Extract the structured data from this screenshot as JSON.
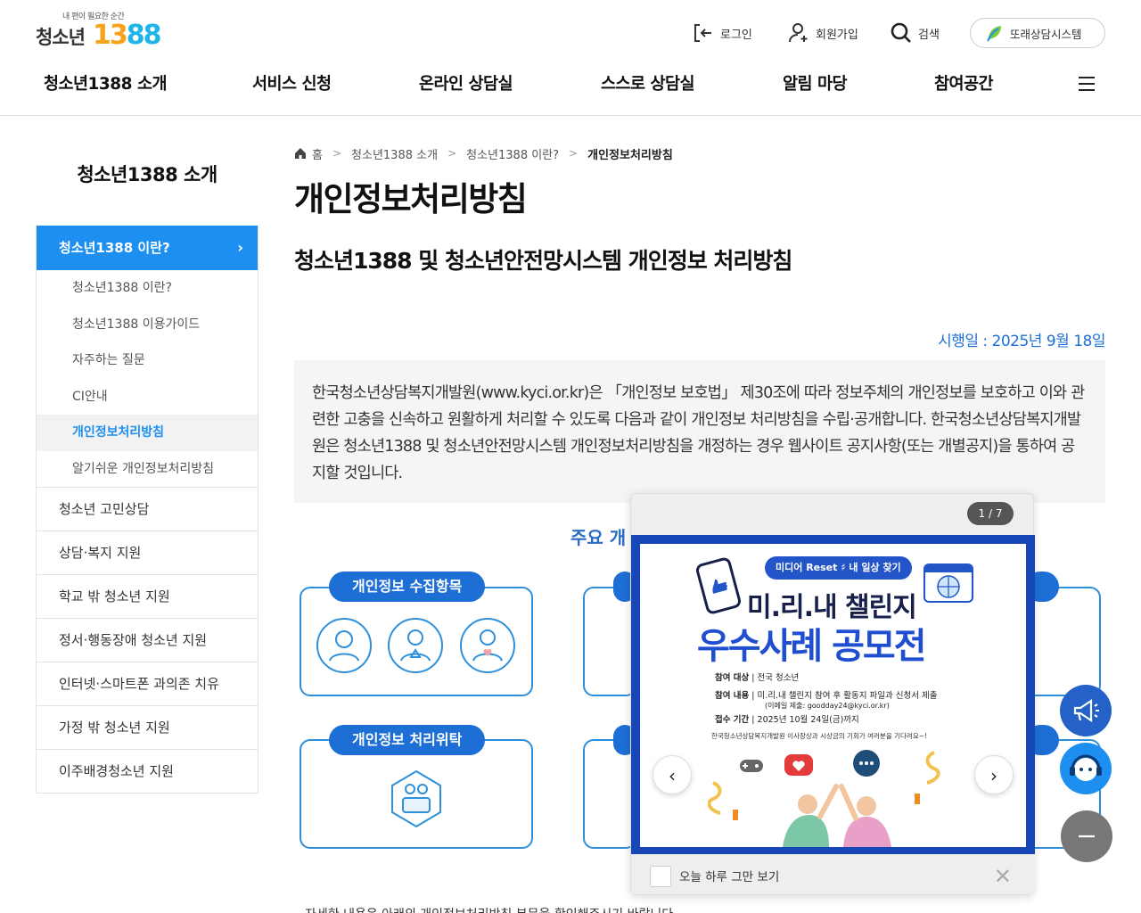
{
  "header": {
    "logo_tagline": "내 편이 필요한 순간",
    "logo_text": "청소년",
    "logo_num_a": "13",
    "logo_num_b": "88",
    "util": {
      "login": "로그인",
      "join": "회원가입",
      "search": "검색",
      "counsel_system": "또래상담시스템"
    },
    "gnb": [
      "청소년1388 소개",
      "서비스 신청",
      "온라인 상담실",
      "스스로 상담실",
      "알림 마당",
      "참여공간"
    ]
  },
  "lnb": {
    "title": "청소년1388 소개",
    "active": "청소년1388 이란?",
    "sub_items": [
      "청소년1388 이란?",
      "청소년1388 이용가이드",
      "자주하는 질문",
      "CI안내",
      "개인정보처리방침",
      "알기쉬운 개인정보처리방침"
    ],
    "main_items": [
      "청소년 고민상담",
      "상담·복지 지원",
      "학교 밖 청소년 지원",
      "정서·행동장애 청소년 지원",
      "인터넷·스마트폰 과의존 치유",
      "가정 밖 청소년 지원",
      "이주배경청소년 지원"
    ]
  },
  "breadcrumb": {
    "home": "홈",
    "level1": "청소년1388 소개",
    "level2": "청소년1388 이란?",
    "current": "개인정보처리방침"
  },
  "content": {
    "page_title": "개인정보처리방침",
    "sub_title": "청소년1388 및 청소년안전망시스템 개인정보 처리방침",
    "effective_date": "시행일 : 2025년 9월 18일",
    "intro": "한국청소년상담복지개발원(www.kyci.or.kr)은 「개인정보 보호법」 제30조에 따라 정보주체의 개인정보를 보호하고 이와 관련한 고충을 신속하고 원활하게 처리할 수 있도록 다음과 같이 개인정보 처리방침을 수립·공개합니다. 한국청소년상담복지개발원은 청소년1388 및 청소년안전망시스템 개인정보처리방침을 개정하는 경우 웹사이트 공지사항(또는 개별공지)을 통하여 공지할 것입니다.",
    "section_head": "주요 개",
    "card1_label": "개인정보 수집항목",
    "card2_label": "개인정보 처리위탁",
    "bottom_text": "자세한 내용은 아래의 개인정보처리방침 본문을 확인해주시기 바랍니다."
  },
  "popup": {
    "counter": "1 / 7",
    "tag": "미디어 Reset ♯ 내 일상 찾기",
    "title1": "미.리.내 챌린지",
    "title2": "우수사례 공모전",
    "info1_label": "참여 대상",
    "info1_value": "전국 청소년",
    "info2_label": "참여 내용",
    "info2_value": "미.리.내 챌린지 참여 후 활동지 파일과 신청서 제출",
    "info2_sub": "(이메일 제출: goodday24@kyci.or.kr)",
    "info3_label": "접수 기간",
    "info3_value": "2025년 10월 24일(금)까지",
    "note": "한국청소년상담복지개발원 이사장상과 시상금의 기회가 여러분을 기다려요~!",
    "footer_text": "오늘 하루 그만 보기"
  }
}
